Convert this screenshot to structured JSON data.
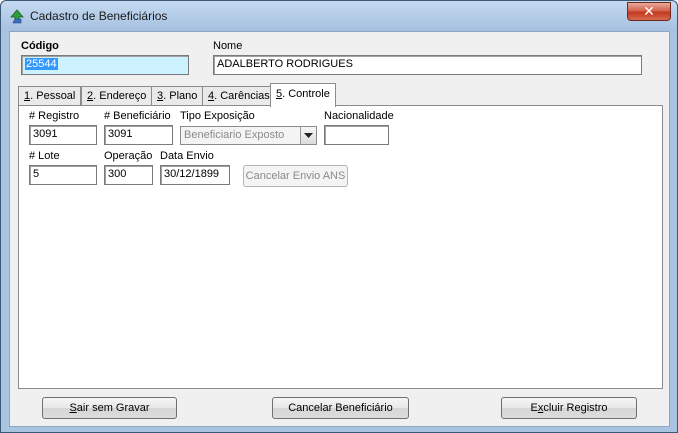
{
  "window": {
    "title": "Cadastro de Beneficiários",
    "close_glyph": "✕",
    "app_icon": "green-arrow-app-icon"
  },
  "header": {
    "codigo_label": "Código",
    "codigo_value": "25544",
    "nome_label": "Nome",
    "nome_value": "ADALBERTO RODRIGUES"
  },
  "tabs": [
    {
      "accel": "1",
      "rest": ". Pessoal",
      "active": false
    },
    {
      "accel": "2",
      "rest": ". Endereço",
      "active": false
    },
    {
      "accel": "3",
      "rest": ". Plano",
      "active": false
    },
    {
      "accel": "4",
      "rest": ". Carências",
      "active": false
    },
    {
      "accel": "5",
      "rest": ". Controle",
      "active": true
    }
  ],
  "controle": {
    "registro_label": "# Registro",
    "registro_value": "3091",
    "beneficiario_label": "# Beneficiário",
    "beneficiario_value": "3091",
    "tipo_exposicao_label": "Tipo Exposição",
    "tipo_exposicao_value": "Beneficiario Exposto",
    "nacionalidade_label": "Nacionalidade",
    "nacionalidade_value": "",
    "lote_label": "# Lote",
    "lote_value": "5",
    "operacao_label": "Operação",
    "operacao_value": "300",
    "data_envio_label": "Data Envio",
    "data_envio_value": "30/12/1899",
    "cancelar_envio_label": "Cancelar Envio ANS"
  },
  "footer": {
    "sair_accel": "S",
    "sair_rest": "air sem Gravar",
    "cancelar_beneficiario_label": "Cancelar Beneficiário",
    "excluir_prefix": "E",
    "excluir_accel": "x",
    "excluir_rest": "cluir Registro"
  },
  "colors": {
    "frame": "#a9c4e0",
    "codigo_bg": "#ccf2ff",
    "selection": "#3399ff",
    "close_button": "#c0391f"
  }
}
